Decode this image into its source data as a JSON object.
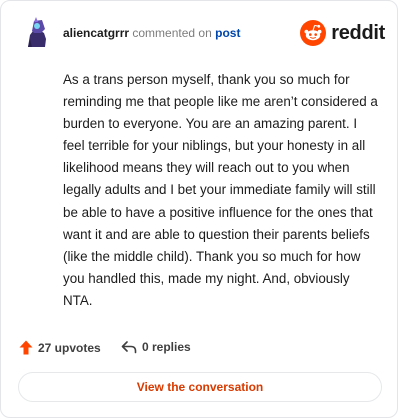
{
  "header": {
    "username": "aliencatgrrr",
    "action_text": "commented on",
    "post_link": "post",
    "logo_text": "reddit"
  },
  "comment": {
    "body": "As a trans person myself, thank you so much for reminding me that people like me aren’t considered a burden to everyone. You are an amazing parent. I feel terrible for your niblings, but your honesty in all likelihood means they will reach out to you when legally adults and I bet your immediate family will still be able to have a positive influence for the ones that want it and are able to question their parents beliefs (like the middle child). Thank you so much for how you handled this, made my night. And, obviously NTA."
  },
  "footer": {
    "upvotes": "27 upvotes",
    "replies": "0 replies",
    "upvote_icon": "upvote-arrow-icon",
    "reply_icon": "reply-arrow-icon"
  },
  "cta": {
    "label": "View the conversation"
  },
  "colors": {
    "accent": "#d93a00",
    "reddit_orange": "#ff4500",
    "link": "#0045ac"
  }
}
